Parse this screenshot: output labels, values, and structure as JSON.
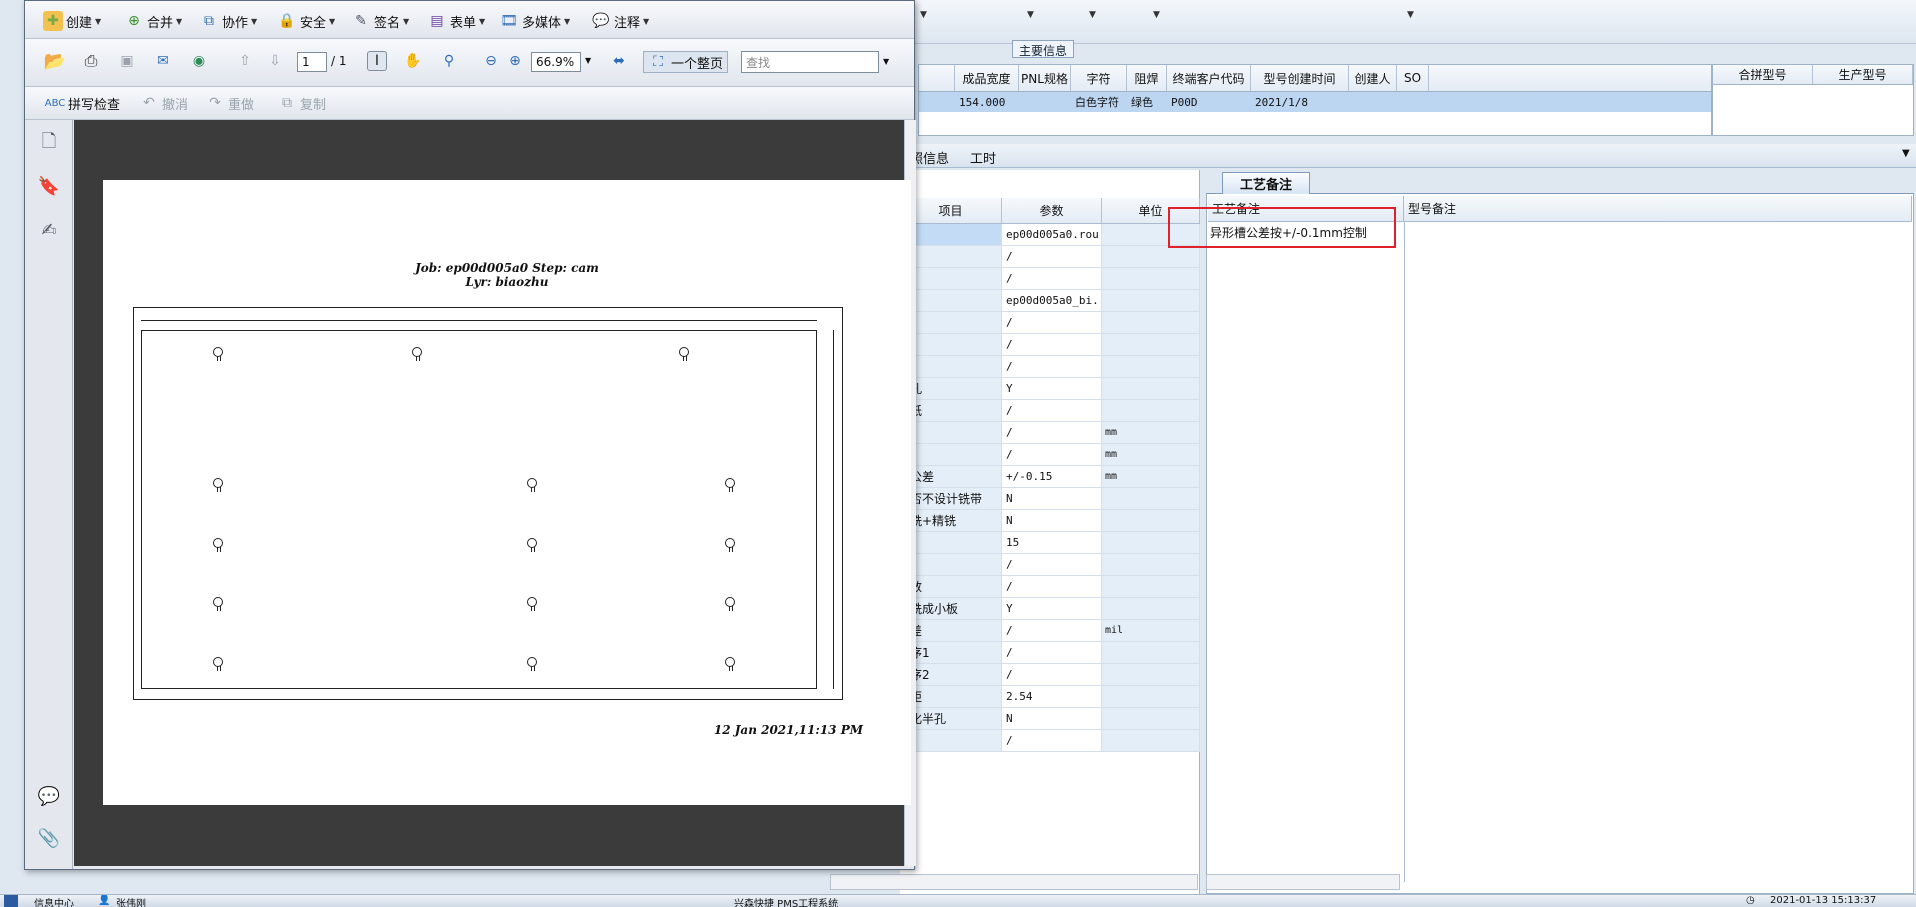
{
  "pdf_toolbar1": {
    "create": "创建",
    "combine": "合并",
    "collaborate": "协作",
    "secure": "安全",
    "sign": "签名",
    "forms": "表单",
    "multimedia": "多媒体",
    "comment": "注释"
  },
  "pdf_toolbar2": {
    "page_current": "1",
    "page_total": "/ 1",
    "zoom": "66.9%",
    "fit_page": "一个整页",
    "search_placeholder": "查找"
  },
  "pdf_toolbar3": {
    "spell_check": "拼写检查",
    "undo": "撤消",
    "redo": "重做",
    "copy": "复制"
  },
  "pdf_page": {
    "job_line": "Job: ep00d005a0  Step: cam",
    "layer_line": "Lyr: biaozhu",
    "timestamp": "12 Jan 2021,11:13 PM"
  },
  "main_info": {
    "group_title": "主要信息",
    "columns": [
      "成品宽度",
      "PNL规格",
      "字符",
      "阻焊",
      "终端客户代码",
      "型号创建时间",
      "创建人",
      "SO"
    ],
    "row": [
      "154.000",
      "",
      "白色字符",
      "绿色",
      "P00D",
      "2021/1/8",
      "",
      ""
    ],
    "side_columns": [
      "合拼型号",
      "生产型号"
    ]
  },
  "tabs2": {
    "info": "照信息",
    "hours": "工时"
  },
  "params": {
    "columns": [
      "项目",
      "参数",
      "单位"
    ],
    "rows": [
      {
        "item": "",
        "value": "ep00d005a0.rou",
        "unit": ""
      },
      {
        "item": "",
        "value": "/",
        "unit": ""
      },
      {
        "item": "",
        "value": "/",
        "unit": ""
      },
      {
        "item": "",
        "value": "ep00d005a0_bi...",
        "unit": ""
      },
      {
        "item": "",
        "value": "/",
        "unit": ""
      },
      {
        "item": "",
        "value": "/",
        "unit": ""
      },
      {
        "item": "",
        "value": "/",
        "unit": ""
      },
      {
        "item": "孔",
        "value": "Y",
        "unit": ""
      },
      {
        "item": "纸",
        "value": "/",
        "unit": ""
      },
      {
        "item": "",
        "value": "/",
        "unit": "mm"
      },
      {
        "item": "",
        "value": "/",
        "unit": "mm"
      },
      {
        "item": "公差",
        "value": "+/-0.15",
        "unit": "mm"
      },
      {
        "item": "否不设计铣带",
        "value": "N",
        "unit": ""
      },
      {
        "item": "铣+精铣",
        "value": "N",
        "unit": ""
      },
      {
        "item": "",
        "value": "15",
        "unit": ""
      },
      {
        "item": "",
        "value": "/",
        "unit": ""
      },
      {
        "item": "数",
        "value": "/",
        "unit": ""
      },
      {
        "item": "铣成小板",
        "value": "Y",
        "unit": ""
      },
      {
        "item": "差",
        "value": "/",
        "unit": "mil"
      },
      {
        "item": "序1",
        "value": "/",
        "unit": ""
      },
      {
        "item": "序2",
        "value": "/",
        "unit": ""
      },
      {
        "item": "距",
        "value": "2.54",
        "unit": ""
      },
      {
        "item": "化半孔",
        "value": "N",
        "unit": ""
      },
      {
        "item": "",
        "value": "/",
        "unit": ""
      }
    ]
  },
  "craft": {
    "tab": "工艺备注",
    "col_craft": "工艺备注",
    "col_model": "型号备注",
    "note": "异形槽公差按+/-0.1mm控制"
  },
  "statusbar": {
    "left": "信息中心",
    "user": "张伟刚",
    "middle": "兴森快捷 PMS工程系统",
    "right": "2021-01-13 15:13:37"
  }
}
